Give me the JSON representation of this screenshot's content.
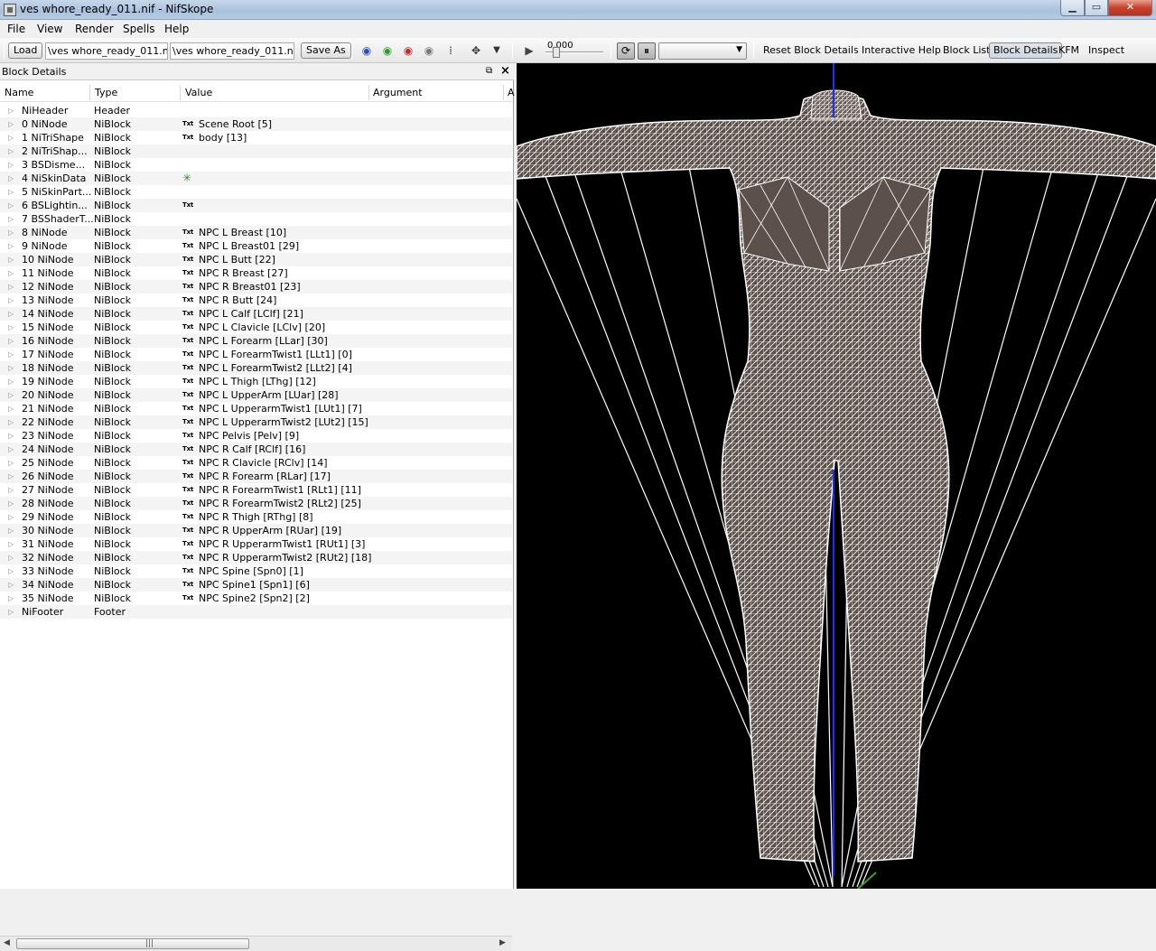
{
  "window": {
    "title": "ves whore_ready_011.nif - NifSkope"
  },
  "menu": [
    "File",
    "View",
    "Render",
    "Spells",
    "Help"
  ],
  "toolbar": {
    "load_label": "Load",
    "load_path": "\\ves whore_ready_011.nif",
    "save_path": "\\ves whore_ready_011.nif",
    "save_as_label": "Save As",
    "time_value": "0.000",
    "links": [
      "Reset Block Details",
      "Interactive Help",
      "Block List",
      "Block Details",
      "KFM",
      "Inspect"
    ]
  },
  "panel": {
    "title": "Block Details",
    "columns": [
      "Name",
      "Type",
      "Value",
      "Argument",
      "A"
    ],
    "rows": [
      {
        "name": "NiHeader",
        "type": "Header",
        "value": "",
        "icon": ""
      },
      {
        "name": "0 NiNode",
        "type": "NiBlock",
        "value": "Scene Root [5]",
        "icon": "Txt"
      },
      {
        "name": "1 NiTriShape",
        "type": "NiBlock",
        "value": "body [13]",
        "icon": "Txt"
      },
      {
        "name": "2 NiTriShap...",
        "type": "NiBlock",
        "value": "",
        "icon": ""
      },
      {
        "name": "3 BSDisme...",
        "type": "NiBlock",
        "value": "",
        "icon": ""
      },
      {
        "name": "4 NiSkinData",
        "type": "NiBlock",
        "value": "",
        "icon": "axes"
      },
      {
        "name": "5 NiSkinPart...",
        "type": "NiBlock",
        "value": "",
        "icon": ""
      },
      {
        "name": "6 BSLightin...",
        "type": "NiBlock",
        "value": "",
        "icon": "Txt"
      },
      {
        "name": "7 BSShaderT...",
        "type": "NiBlock",
        "value": "",
        "icon": ""
      },
      {
        "name": "8 NiNode",
        "type": "NiBlock",
        "value": "NPC L Breast [10]",
        "icon": "Txt"
      },
      {
        "name": "9 NiNode",
        "type": "NiBlock",
        "value": "NPC L Breast01 [29]",
        "icon": "Txt"
      },
      {
        "name": "10 NiNode",
        "type": "NiBlock",
        "value": "NPC L Butt [22]",
        "icon": "Txt"
      },
      {
        "name": "11 NiNode",
        "type": "NiBlock",
        "value": "NPC R Breast [27]",
        "icon": "Txt"
      },
      {
        "name": "12 NiNode",
        "type": "NiBlock",
        "value": "NPC R Breast01 [23]",
        "icon": "Txt"
      },
      {
        "name": "13 NiNode",
        "type": "NiBlock",
        "value": "NPC R Butt [24]",
        "icon": "Txt"
      },
      {
        "name": "14 NiNode",
        "type": "NiBlock",
        "value": "NPC L Calf [LClf] [21]",
        "icon": "Txt"
      },
      {
        "name": "15 NiNode",
        "type": "NiBlock",
        "value": "NPC L Clavicle [LClv] [20]",
        "icon": "Txt"
      },
      {
        "name": "16 NiNode",
        "type": "NiBlock",
        "value": "NPC L Forearm [LLar] [30]",
        "icon": "Txt"
      },
      {
        "name": "17 NiNode",
        "type": "NiBlock",
        "value": "NPC L ForearmTwist1 [LLt1] [0]",
        "icon": "Txt"
      },
      {
        "name": "18 NiNode",
        "type": "NiBlock",
        "value": "NPC L ForearmTwist2 [LLt2] [4]",
        "icon": "Txt"
      },
      {
        "name": "19 NiNode",
        "type": "NiBlock",
        "value": "NPC L Thigh [LThg] [12]",
        "icon": "Txt"
      },
      {
        "name": "20 NiNode",
        "type": "NiBlock",
        "value": "NPC L UpperArm [LUar] [28]",
        "icon": "Txt"
      },
      {
        "name": "21 NiNode",
        "type": "NiBlock",
        "value": "NPC L UpperarmTwist1 [LUt1] [7]",
        "icon": "Txt"
      },
      {
        "name": "22 NiNode",
        "type": "NiBlock",
        "value": "NPC L UpperarmTwist2 [LUt2] [15]",
        "icon": "Txt"
      },
      {
        "name": "23 NiNode",
        "type": "NiBlock",
        "value": "NPC Pelvis [Pelv] [9]",
        "icon": "Txt"
      },
      {
        "name": "24 NiNode",
        "type": "NiBlock",
        "value": "NPC R Calf [RClf] [16]",
        "icon": "Txt"
      },
      {
        "name": "25 NiNode",
        "type": "NiBlock",
        "value": "NPC R Clavicle [RClv] [14]",
        "icon": "Txt"
      },
      {
        "name": "26 NiNode",
        "type": "NiBlock",
        "value": "NPC R Forearm [RLar] [17]",
        "icon": "Txt"
      },
      {
        "name": "27 NiNode",
        "type": "NiBlock",
        "value": "NPC R ForearmTwist1 [RLt1] [11]",
        "icon": "Txt"
      },
      {
        "name": "28 NiNode",
        "type": "NiBlock",
        "value": "NPC R ForearmTwist2 [RLt2] [25]",
        "icon": "Txt"
      },
      {
        "name": "29 NiNode",
        "type": "NiBlock",
        "value": "NPC R Thigh [RThg] [8]",
        "icon": "Txt"
      },
      {
        "name": "30 NiNode",
        "type": "NiBlock",
        "value": "NPC R UpperArm [RUar] [19]",
        "icon": "Txt"
      },
      {
        "name": "31 NiNode",
        "type": "NiBlock",
        "value": "NPC R UpperarmTwist1 [RUt1] [3]",
        "icon": "Txt"
      },
      {
        "name": "32 NiNode",
        "type": "NiBlock",
        "value": "NPC R UpperarmTwist2 [RUt2] [18]",
        "icon": "Txt"
      },
      {
        "name": "33 NiNode",
        "type": "NiBlock",
        "value": "NPC Spine [Spn0] [1]",
        "icon": "Txt"
      },
      {
        "name": "34 NiNode",
        "type": "NiBlock",
        "value": "NPC Spine1 [Spn1] [6]",
        "icon": "Txt"
      },
      {
        "name": "35 NiNode",
        "type": "NiBlock",
        "value": "NPC Spine2 [Spn2] [2]",
        "icon": "Txt"
      },
      {
        "name": "NiFooter",
        "type": "Footer",
        "value": "",
        "icon": ""
      }
    ]
  },
  "icons": {
    "row_expand": "triangle-right-icon",
    "string_value": "txt-icon",
    "skin_data": "axes-icon",
    "play": "play-icon"
  },
  "colors": {
    "viewport_bg": "#000000",
    "mesh": "#ffffff",
    "mesh_fill": "#5b504a",
    "axis_blue": "#1f2cff",
    "axis_green": "#2aa82a"
  }
}
